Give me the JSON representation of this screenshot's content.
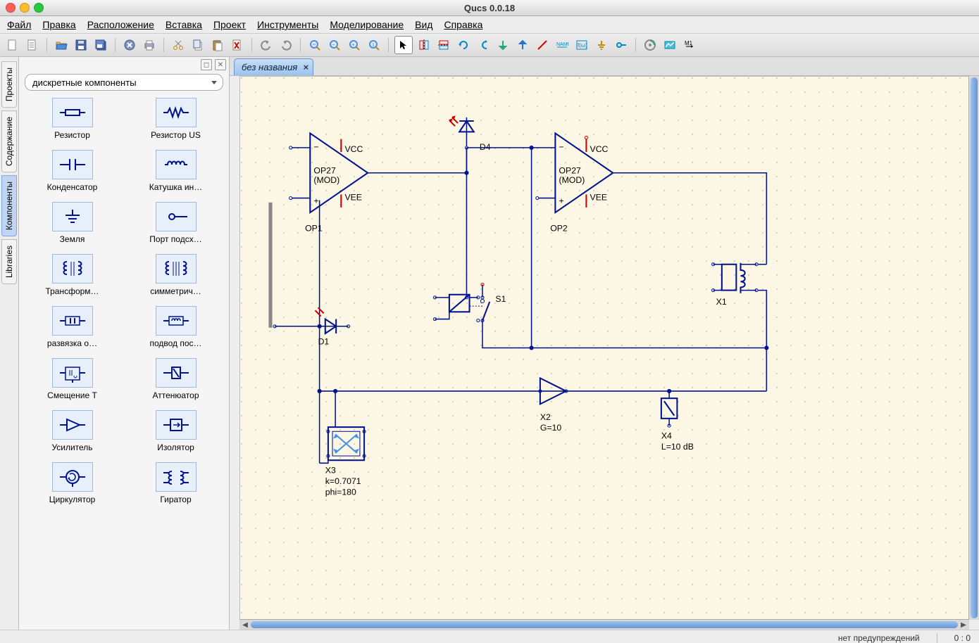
{
  "window": {
    "title": "Qucs 0.0.18"
  },
  "menu": {
    "items": [
      {
        "label": "Файл"
      },
      {
        "label": "Правка"
      },
      {
        "label": "Расположение"
      },
      {
        "label": "Вставка"
      },
      {
        "label": "Проект"
      },
      {
        "label": "Инструменты"
      },
      {
        "label": "Моделирование"
      },
      {
        "label": "Вид"
      },
      {
        "label": "Справка"
      }
    ]
  },
  "side_tabs": {
    "items": [
      {
        "label": "Проекты",
        "active": false
      },
      {
        "label": "Содержание",
        "active": false
      },
      {
        "label": "Компоненты",
        "active": true
      },
      {
        "label": "Libraries",
        "active": false
      }
    ]
  },
  "panel": {
    "combo_selected": "дискретные компоненты",
    "components": [
      {
        "label": "Резистор",
        "icon": "resistor"
      },
      {
        "label": "Резистор US",
        "icon": "resistor-us"
      },
      {
        "label": "Конденсатор",
        "icon": "capacitor"
      },
      {
        "label": "Катушка ин…",
        "icon": "inductor"
      },
      {
        "label": "Земля",
        "icon": "ground"
      },
      {
        "label": "Порт подсх…",
        "icon": "port"
      },
      {
        "label": "Трансформ…",
        "icon": "transformer"
      },
      {
        "label": "симметрич…",
        "icon": "transformer2"
      },
      {
        "label": "развязка о…",
        "icon": "dcblock"
      },
      {
        "label": "подвод пос…",
        "icon": "dcfeed"
      },
      {
        "label": "Смещение Т",
        "icon": "biastee"
      },
      {
        "label": "Аттенюатор",
        "icon": "attenuator"
      },
      {
        "label": "Усилитель",
        "icon": "amplifier"
      },
      {
        "label": "Изолятор",
        "icon": "isolator"
      },
      {
        "label": "Циркулятор",
        "icon": "circulator"
      },
      {
        "label": "Гиратор",
        "icon": "gyrator"
      }
    ]
  },
  "doc_tabs": {
    "items": [
      {
        "label": "без названия",
        "active": true
      }
    ]
  },
  "schematic": {
    "op1": {
      "name": "OP1",
      "model1": "OP27",
      "model2": "(MOD)",
      "vcc": "VCC",
      "vee": "VEE"
    },
    "op2": {
      "name": "OP2",
      "model1": "OP27",
      "model2": "(MOD)",
      "vcc": "VCC",
      "vee": "VEE"
    },
    "d1": "D1",
    "d4": "D4",
    "s1": "S1",
    "x1": "X1",
    "x2": {
      "name": "X2",
      "p1": "G=10"
    },
    "x3": {
      "name": "X3",
      "p1": "k=0.7071",
      "p2": "phi=180"
    },
    "x4": {
      "name": "X4",
      "p1": "L=10 dB"
    }
  },
  "status": {
    "warnings": "нет предупреждений",
    "coords": "0 : 0"
  }
}
